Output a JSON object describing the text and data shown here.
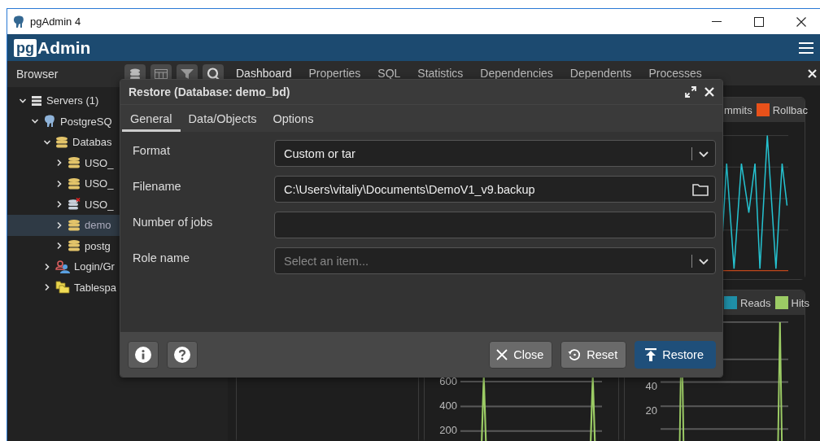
{
  "window": {
    "title": "pgAdmin 4"
  },
  "brand": {
    "logo_mark": "pg",
    "logo_text": "Admin"
  },
  "browser": {
    "title": "Browser",
    "tree": [
      {
        "label": "Servers (1)",
        "kind": "servers",
        "expanded": true,
        "selected": false,
        "children": [
          {
            "label": "PostgreSQ",
            "kind": "server",
            "expanded": true,
            "selected": false,
            "children": [
              {
                "label": "Databas",
                "kind": "databases",
                "expanded": true,
                "selected": false,
                "children": [
                  {
                    "label": "USO_",
                    "kind": "database",
                    "expanded": false,
                    "selected": false
                  },
                  {
                    "label": "USO_",
                    "kind": "database",
                    "expanded": false,
                    "selected": false
                  },
                  {
                    "label": "USO_",
                    "kind": "database-error",
                    "expanded": false,
                    "selected": false
                  },
                  {
                    "label": "demo",
                    "kind": "database",
                    "expanded": false,
                    "selected": true
                  },
                  {
                    "label": "postg",
                    "kind": "database",
                    "expanded": false,
                    "selected": false
                  }
                ]
              },
              {
                "label": "Login/Gr",
                "kind": "roles",
                "expanded": false,
                "selected": false
              },
              {
                "label": "Tablespa",
                "kind": "tablespaces",
                "expanded": false,
                "selected": false
              }
            ]
          }
        ]
      }
    ]
  },
  "tabs": [
    {
      "label": "Dashboard",
      "selected": true
    },
    {
      "label": "Properties",
      "selected": false
    },
    {
      "label": "SQL",
      "selected": false
    },
    {
      "label": "Statistics",
      "selected": false
    },
    {
      "label": "Dependencies",
      "selected": false
    },
    {
      "label": "Dependents",
      "selected": false
    },
    {
      "label": "Processes",
      "selected": false
    }
  ],
  "dashboard": {
    "panels": [
      {
        "kind": "zigzag",
        "legend": [
          {
            "label": "mmits"
          },
          {
            "label": "Rollbac",
            "color": "#e8511a"
          }
        ]
      },
      {
        "kind": "empty"
      },
      {
        "kind": "spikes",
        "ticks": [
          "600",
          "400",
          "200"
        ]
      },
      {
        "kind": "spikes",
        "legend": [
          {
            "label": "Reads",
            "color": "#1f8fa8"
          },
          {
            "label": "Hits",
            "color": "#9ccc65"
          }
        ],
        "ticks": [
          "40",
          "20"
        ]
      }
    ]
  },
  "dialog": {
    "title": "Restore (Database: demo_bd)",
    "tabs": [
      {
        "label": "General",
        "selected": true
      },
      {
        "label": "Data/Objects",
        "selected": false
      },
      {
        "label": "Options",
        "selected": false
      }
    ],
    "fields": [
      {
        "label": "Format",
        "kind": "select",
        "value": "Custom or tar"
      },
      {
        "label": "Filename",
        "kind": "file",
        "value": "C:\\Users\\vitaliy\\Documents\\DemoV1_v9.backup"
      },
      {
        "label": "Number of jobs",
        "kind": "text"
      },
      {
        "label": "Role name",
        "kind": "select",
        "placeholder": "Select an item..."
      }
    ],
    "buttons": [
      {
        "label": "Close",
        "kind": "close"
      },
      {
        "label": "Reset",
        "kind": "reset"
      },
      {
        "label": "Restore",
        "kind": "restore"
      }
    ]
  }
}
